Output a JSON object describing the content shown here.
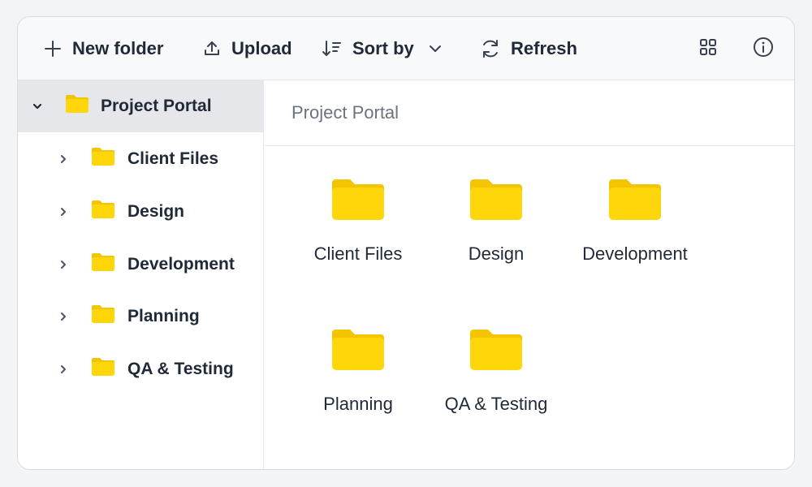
{
  "toolbar": {
    "new_folder": "New folder",
    "upload": "Upload",
    "sort_by": "Sort by",
    "refresh": "Refresh"
  },
  "sidebar": {
    "root": {
      "label": "Project Portal",
      "expanded": true,
      "selected": true
    },
    "items": [
      {
        "label": "Client Files"
      },
      {
        "label": "Design"
      },
      {
        "label": "Development"
      },
      {
        "label": "Planning"
      },
      {
        "label": "QA & Testing"
      }
    ]
  },
  "main": {
    "breadcrumb": "Project Portal",
    "folders": [
      {
        "label": "Client Files"
      },
      {
        "label": "Design"
      },
      {
        "label": "Development"
      },
      {
        "label": "Planning"
      },
      {
        "label": "QA & Testing"
      }
    ]
  },
  "colors": {
    "folder": "#ffd60a",
    "folder_dark": "#f5c400",
    "selected_row": "#e5e7eb",
    "text": "#1f2937",
    "muted": "#6b7280"
  }
}
